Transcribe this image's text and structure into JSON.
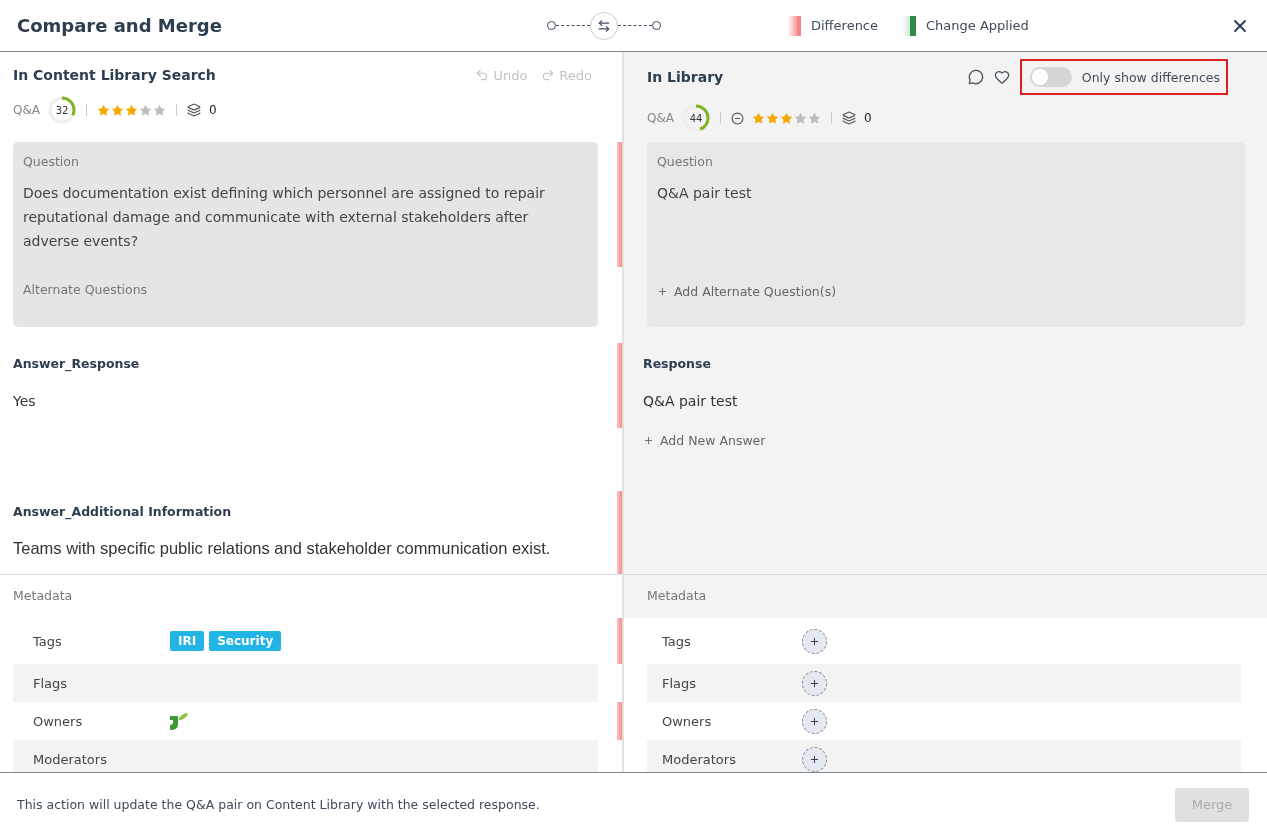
{
  "header": {
    "title": "Compare and Merge",
    "legend": [
      {
        "kind": "difference",
        "label": "Difference"
      },
      {
        "kind": "applied",
        "label": "Change Applied"
      }
    ]
  },
  "left": {
    "title": "In Content Library Search",
    "actions": [
      {
        "kind": "undo",
        "label": "Undo",
        "disabled": true
      },
      {
        "kind": "redo",
        "label": "Redo",
        "disabled": true
      }
    ],
    "stats": {
      "type": "Q&A",
      "score": "32",
      "level": 0.32,
      "stars": 3,
      "count": "0"
    }
  },
  "right": {
    "title": "In Library",
    "favorite": false,
    "toggle": {
      "label": "Only show differences",
      "on": false,
      "highlighted": true
    },
    "stats": {
      "type": "Q&A",
      "score": "44",
      "level": 0.44,
      "stars": 3,
      "count": "0",
      "stars_clearable": true
    }
  },
  "sections": [
    {
      "kind": "question",
      "difference": true,
      "left": {
        "label": "Question",
        "text": "Does documentation exist defining which personnel are assigned to repair reputational damage and communicate with external stakeholders after adverse events?",
        "secondary": "Alternate Questions"
      },
      "right": {
        "label": "Question",
        "text": "Q&A pair test",
        "add": "Add Alternate Question(s)"
      }
    },
    {
      "kind": "answer",
      "difference": true,
      "left": {
        "label": "Answer_Response",
        "text": "Yes"
      },
      "right": {
        "label": "Response",
        "text": "Q&A pair test",
        "add": "Add New Answer"
      }
    },
    {
      "kind": "info",
      "difference": true,
      "left": {
        "label": "Answer_Additional Information",
        "text": "Teams with specific public relations and stakeholder communication exist."
      }
    }
  ],
  "metadata": {
    "left_heading": "Metadata",
    "right_heading": "Metadata",
    "rows": [
      {
        "left_label": "Tags",
        "right_label": "Tags",
        "difference": true,
        "left": {
          "kind": "tags",
          "tags": [
            "IRI",
            "Security"
          ]
        },
        "right": {
          "kind": "add"
        }
      },
      {
        "left_label": "Flags",
        "right_label": "Flags",
        "difference": false,
        "right": {
          "kind": "add"
        }
      },
      {
        "left_label": "Owners",
        "right_label": "Owners",
        "difference": true,
        "left": {
          "kind": "avatar"
        },
        "right": {
          "kind": "add"
        }
      },
      {
        "left_label": "Moderators",
        "right_label": "Moderators",
        "difference": false,
        "right": {
          "kind": "add"
        }
      }
    ]
  },
  "footer": {
    "message": "This action will update the Q&A pair on Content Library with the selected response.",
    "button": {
      "label": "Merge",
      "disabled": true
    }
  }
}
